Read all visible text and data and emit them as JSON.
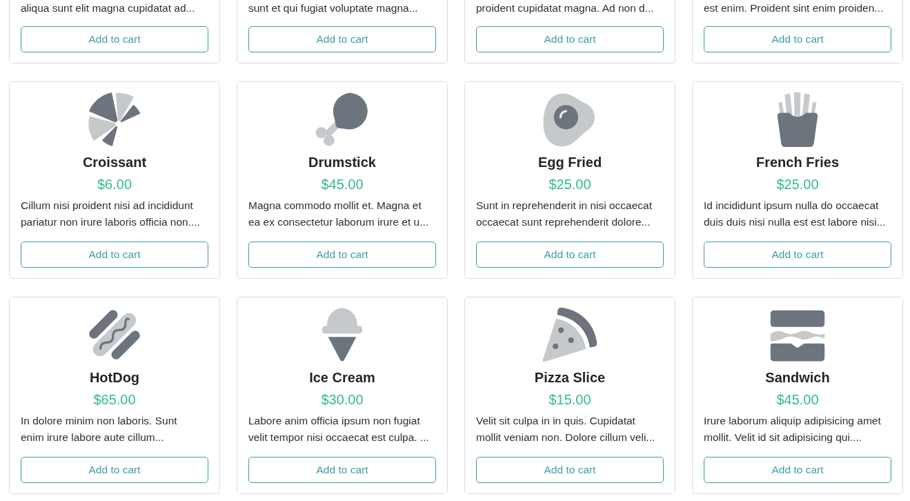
{
  "product_grid": {
    "cut_off_row": [
      {
        "description": "aliqua sunt elit magna cupidatat ad...",
        "button": "Add to cart"
      },
      {
        "description": "sunt et qui fugiat voluptate magna...",
        "button": "Add to cart"
      },
      {
        "description": "proident cupidatat magna. Ad non d...",
        "button": "Add to cart"
      },
      {
        "description": "est enim. Proident sint enim proiden...",
        "button": "Add to cart"
      }
    ],
    "products": [
      {
        "kind": "croissant",
        "name": "Croissant",
        "price": "$6.00",
        "description_lines": [
          "Cillum nisi proident nisi ad incididunt",
          "pariatur non irure laboris officia non...."
        ],
        "button": "Add to cart"
      },
      {
        "kind": "drumstick",
        "name": "Drumstick",
        "price": "$45.00",
        "description_lines": [
          "Magna commodo mollit et. Magna et",
          "ea ex consectetur laborum irure et u..."
        ],
        "button": "Add to cart"
      },
      {
        "kind": "egg",
        "name": "Egg Fried",
        "price": "$25.00",
        "description_lines": [
          "Sunt in reprehenderit in nisi occaecat",
          "occaecat sunt reprehenderit dolore..."
        ],
        "button": "Add to cart"
      },
      {
        "kind": "fries",
        "name": "French Fries",
        "price": "$25.00",
        "description_lines": [
          "Id incididunt ipsum nulla do occaecat",
          "duis duis nisi nulla est est labore nisi..."
        ],
        "button": "Add to cart"
      },
      {
        "kind": "hotdog",
        "name": "HotDog",
        "price": "$65.00",
        "description_lines": [
          "In dolore minim non laboris. Sunt",
          "enim irure labore aute cillum..."
        ],
        "button": "Add to cart"
      },
      {
        "kind": "icecream",
        "name": "Ice Cream",
        "price": "$30.00",
        "description_lines": [
          "Labore anim officia ipsum non fugiat",
          "velit tempor nisi occaecat est culpa. ..."
        ],
        "button": "Add to cart"
      },
      {
        "kind": "pizza",
        "name": "Pizza Slice",
        "price": "$15.00",
        "description_lines": [
          "Velit sit culpa in in quis. Cupidatat",
          "mollit veniam non. Dolore cillum veli..."
        ],
        "button": "Add to cart"
      },
      {
        "kind": "sandwich",
        "name": "Sandwich",
        "price": "$45.00",
        "description_lines": [
          "Irure laborum aliquip adipisicing amet",
          "mollit. Velit id sit adipisicing qui...."
        ],
        "button": "Add to cart"
      }
    ]
  }
}
